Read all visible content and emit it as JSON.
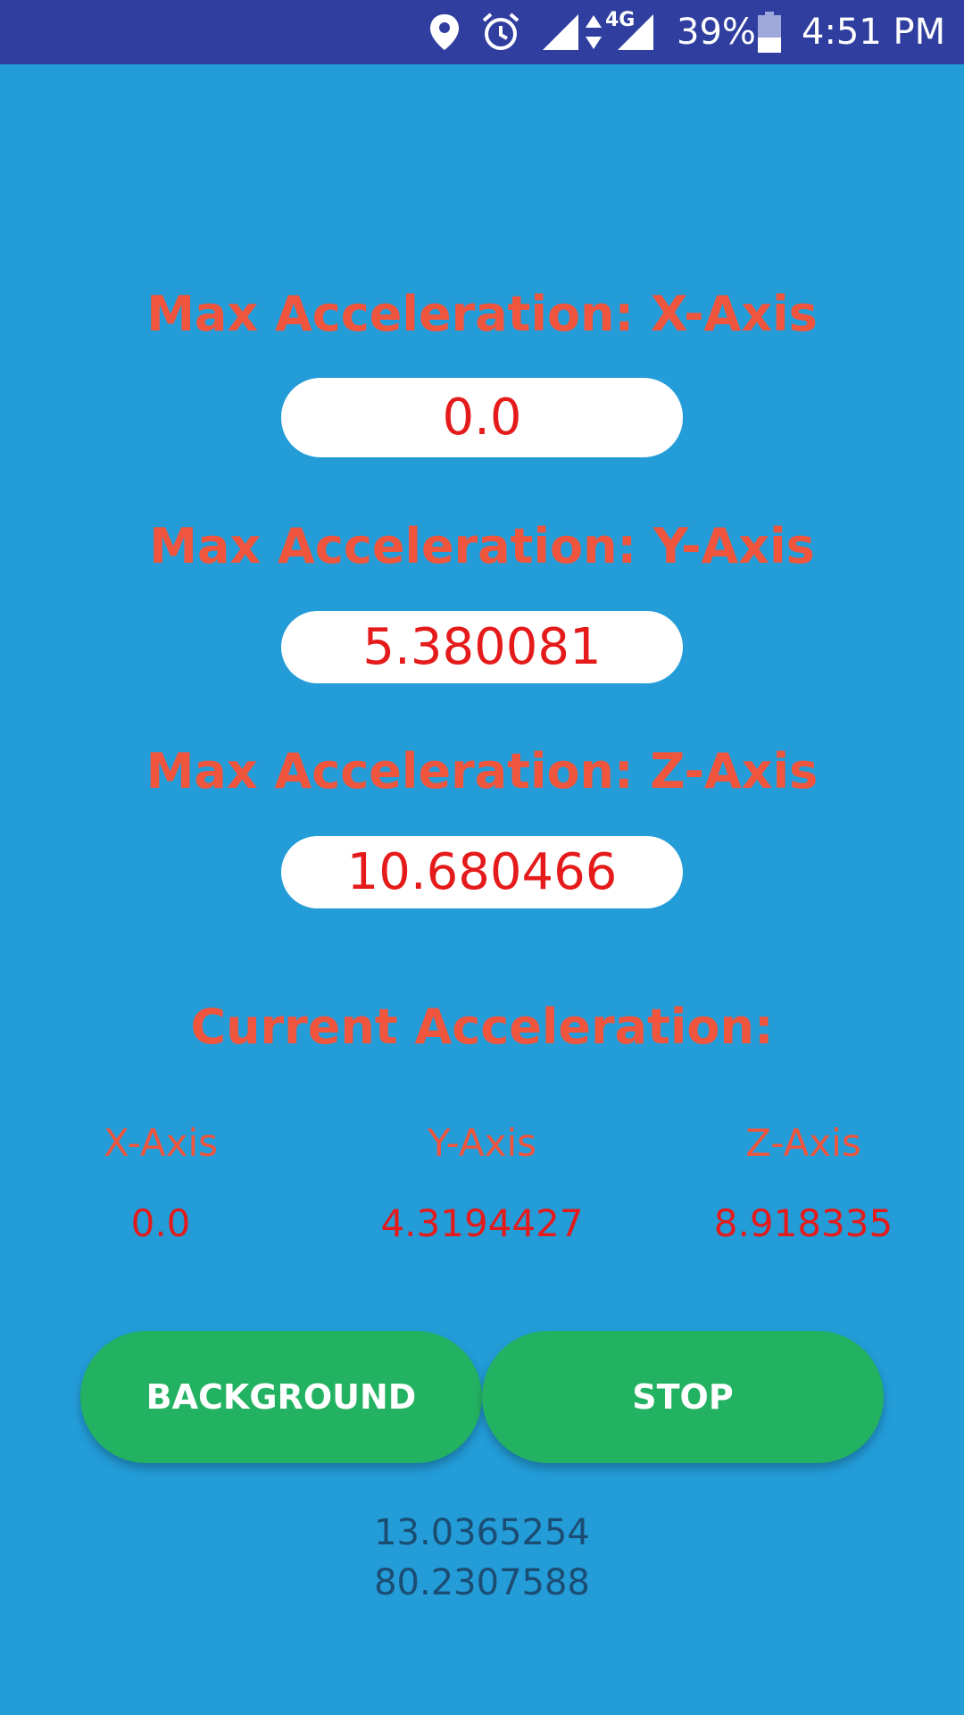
{
  "status_bar": {
    "battery_percent": "39%",
    "time": "4:51 PM",
    "network": "4G",
    "icons": [
      "location-pin-icon",
      "alarm-clock-icon",
      "signal-icon",
      "data-arrows-icon",
      "signal-icon",
      "battery-icon"
    ],
    "background_color": "#303f9f"
  },
  "max_acceleration": [
    {
      "label": "Max Acceleration: X-Axis",
      "value": "0.0"
    },
    {
      "label": "Max Acceleration: Y-Axis",
      "value": "5.380081"
    },
    {
      "label": "Max Acceleration: Z-Axis",
      "value": "10.680466"
    }
  ],
  "current": {
    "title": "Current Acceleration:",
    "axes": [
      {
        "label": "X-Axis",
        "value": "0.0"
      },
      {
        "label": "Y-Axis",
        "value": "4.3194427"
      },
      {
        "label": "Z-Axis",
        "value": "8.918335"
      }
    ]
  },
  "buttons": {
    "background_label": "BACKGROUND",
    "stop_label": "STOP"
  },
  "coordinates": {
    "line1": "13.0365254",
    "line2": "80.2307588"
  },
  "colors": {
    "background": "#239cd8",
    "label": "#f0553e",
    "value": "#e51b1b",
    "button": "#23b262",
    "coords_text": "#1b4d73"
  }
}
